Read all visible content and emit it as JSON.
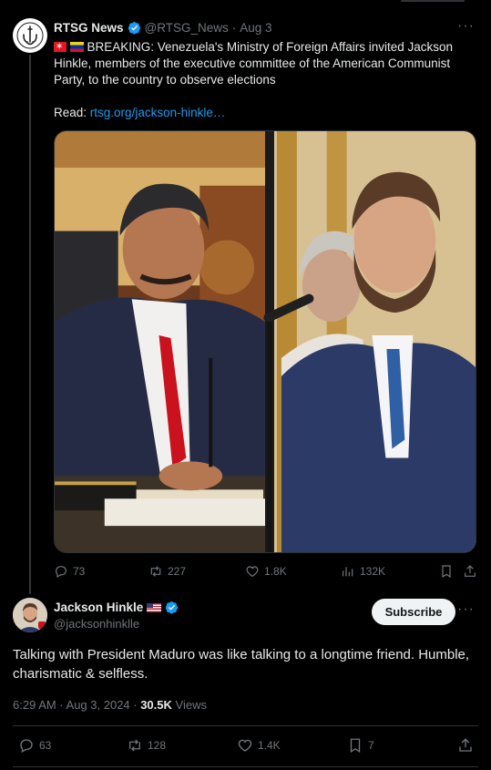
{
  "parent_tweet": {
    "author_name": "RTSG News",
    "handle": "@RTSG_News",
    "separator": "·",
    "date": "Aug 3",
    "more": "···",
    "text_breaking": " BREAKING: Venezuela's Ministry of Foreign Affairs invited Jackson Hinkle, members of the executive committee of the American Communist Party, to the country to observe elections",
    "read_label": "Read:",
    "link_text": "rtsg.org/jackson-hinkle…",
    "stats": {
      "replies": "73",
      "reposts": "227",
      "likes": "1.8K",
      "views": "132K"
    }
  },
  "main_tweet": {
    "author_name": "Jackson Hinkle",
    "handle": "@jacksonhinklle",
    "subscribe_label": "Subscribe",
    "more": "···",
    "text": "Talking with President Maduro was like talking to a longtime friend. Humble, charismatic & selfless.",
    "time_date": "6:29 AM · Aug 3, 2024 · ",
    "views_count": "30.5K",
    "views_label": " Views",
    "stats": {
      "replies": "63",
      "reposts": "128",
      "likes": "1.4K",
      "bookmarks": "7"
    }
  },
  "colors": {
    "background": "#000000",
    "text": "#e7e9ea",
    "muted": "#71767b",
    "link": "#1d9bf0",
    "verified": "#1d9bf0",
    "divider": "#2f3336"
  },
  "icons": {
    "reply": "reply-icon",
    "repost": "repost-icon",
    "like": "heart-icon",
    "views": "views-chart-icon",
    "bookmark": "bookmark-icon",
    "share": "share-icon",
    "verified": "verified-badge-icon"
  }
}
